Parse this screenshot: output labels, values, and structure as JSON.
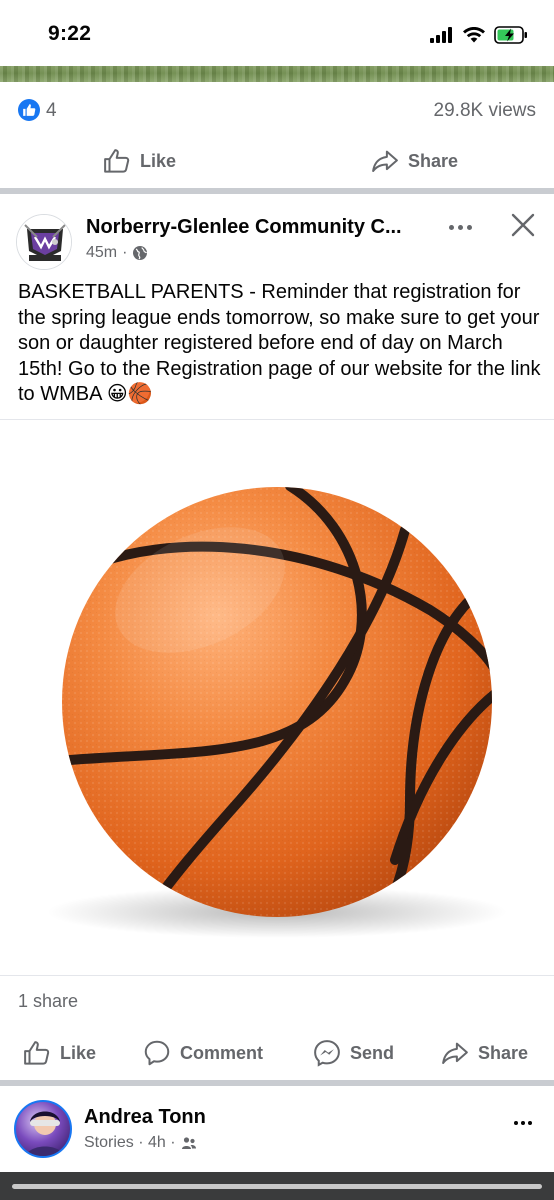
{
  "status_bar": {
    "time": "9:22",
    "icons": [
      "signal-icon",
      "wifi-icon",
      "battery-charging-icon"
    ]
  },
  "previous_post": {
    "reaction_count": "4",
    "views": "29.8K views",
    "actions": {
      "like": "Like",
      "share": "Share"
    }
  },
  "post": {
    "page_name": "Norberry-Glenlee Community C...",
    "time_ago": "45m",
    "separator": "·",
    "audience_icon": "globe-icon",
    "text": "BASKETBALL PARENTS - Reminder that registration for the spring league ends tomorrow, so make sure to get your son or daughter registered before end of day on March 15th!  Go to the Registration page of our website for the link to WMBA 😀🏀",
    "image_subject": "basketball",
    "share_count": "1 share",
    "actions": {
      "like": "Like",
      "comment": "Comment",
      "send": "Send",
      "share": "Share"
    }
  },
  "next_story": {
    "name": "Andrea Tonn",
    "meta": "Stories · 4h ·",
    "audience_icon": "friends-icon"
  },
  "colors": {
    "accent": "#1877f2",
    "secondary_text": "#65676b",
    "divider": "#c9ccd1",
    "ball_orange": "#f07a2c"
  }
}
